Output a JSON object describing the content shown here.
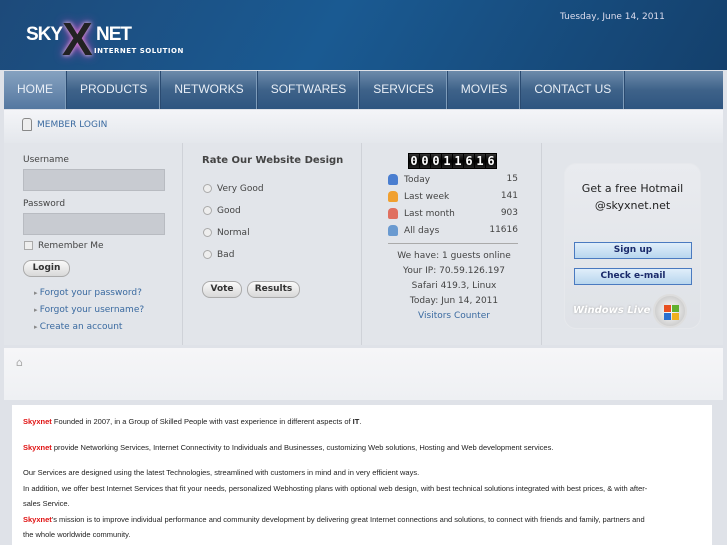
{
  "header": {
    "logo_text": "SKYXNET",
    "logo_sub": "INTERNET SOLUTION",
    "date": "Tuesday, June 14, 2011"
  },
  "nav": [
    "HOME",
    "PRODUCTS",
    "NETWORKS",
    "SOFTWARES",
    "SERVICES",
    "MOVIES",
    "CONTACT US"
  ],
  "member_login": "MEMBER LOGIN",
  "login": {
    "username_label": "Username",
    "password_label": "Password",
    "remember": "Remember Me",
    "login_btn": "Login",
    "links": [
      "Forgot your password?",
      "Forgot your username?",
      "Create an account"
    ]
  },
  "poll": {
    "title": "Rate Our Website Design",
    "options": [
      "Very Good",
      "Good",
      "Normal",
      "Bad"
    ],
    "vote": "Vote",
    "results": "Results"
  },
  "counter": {
    "digits": "00011616",
    "rows": [
      {
        "label": "Today",
        "value": "15",
        "color": "#4a7ed0"
      },
      {
        "label": "Last week",
        "value": "141",
        "color": "#f0a030"
      },
      {
        "label": "Last month",
        "value": "903",
        "color": "#e07060"
      },
      {
        "label": "All days",
        "value": "11616",
        "color": "#6a9ad0"
      }
    ],
    "info": [
      "We have: 1 guests online",
      "Your IP: 70.59.126.197",
      "Safari 419.3, Linux",
      "Today: Jun 14, 2011"
    ],
    "link": "Visitors Counter"
  },
  "hotmail": {
    "line1": "Get a free Hotmail",
    "line2": "@skyxnet.net",
    "signup": "Sign up",
    "check": "Check e-mail",
    "brand": "Windows Live"
  },
  "content": {
    "brand": "Skyxnet",
    "p1": " Founded in 2007, in a Group of Skilled People with vast experience in different aspects of ",
    "p1_bold": "IT",
    "p1_end": ".",
    "p2": " provide Networking Services, Internet Connectivity to Individuals and Businesses, customizing Web solutions, Hosting   and Web development services.",
    "p3": "Our Services are designed using the latest Technologies, streamlined with customers in mind and in very efficient ways.",
    "p4": "In addition, we offer best Internet Services that fit your needs, personalized Webhosting plans with optional web design,  with best technical solutions integrated with best prices, & with after-",
    "p5": "sales Service.",
    "p6": "'s mission is to improve individual performance and community development by delivering great Internet connections and solutions, to connect with friends and family, partners and",
    "p7": "the whole worldwide community."
  }
}
